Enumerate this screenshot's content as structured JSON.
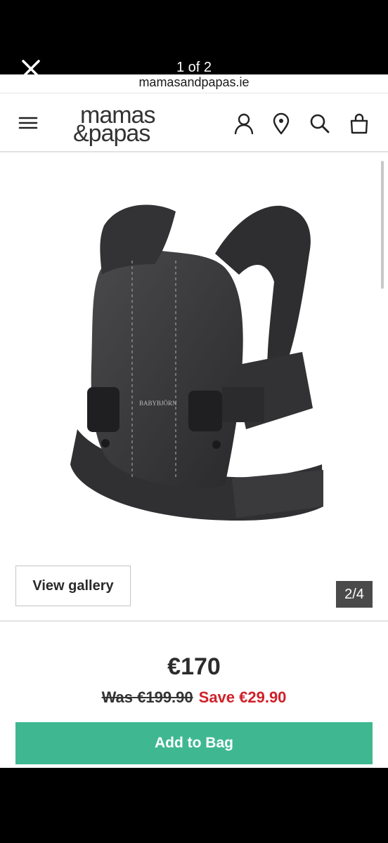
{
  "viewer": {
    "counter": "1 of 2",
    "close_icon": "close-icon"
  },
  "browser": {
    "url": "mamasandpapas.ie"
  },
  "header": {
    "logo_line1": "mamas",
    "logo_line2": "&papas",
    "icons": [
      "hamburger-menu-icon",
      "account-icon",
      "store-locator-icon",
      "search-icon",
      "shopping-bag-icon"
    ]
  },
  "product": {
    "image_brand_label": "BABYBJÖRN",
    "view_gallery_label": "View gallery",
    "gallery_position": "2/4",
    "price": "€170",
    "was_price": "Was €199.90",
    "save_text": "Save €29.90",
    "add_to_bag_label": "Add to Bag"
  },
  "colors": {
    "accent": "#3fb891",
    "sale_red": "#d1202a",
    "text_dark": "#2c2c2c"
  }
}
